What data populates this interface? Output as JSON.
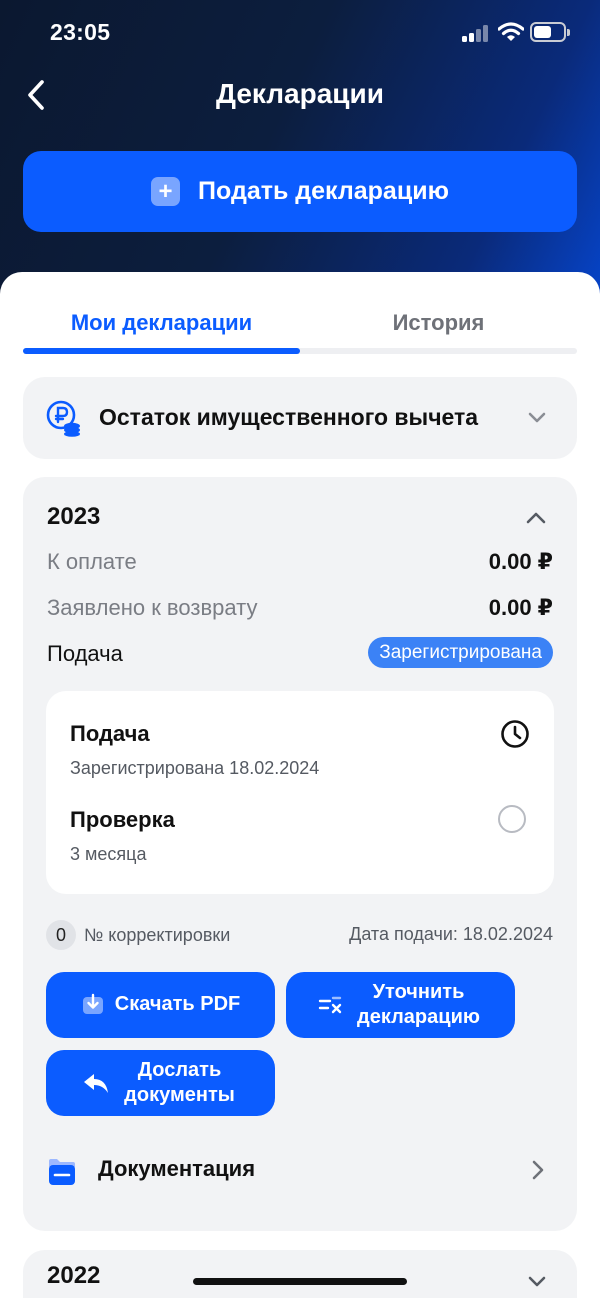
{
  "status_bar": {
    "time": "23:05"
  },
  "header": {
    "title": "Декларации",
    "submit_label": "Подать декларацию"
  },
  "tabs": [
    {
      "label": "Мои декларации",
      "active": true
    },
    {
      "label": "История",
      "active": false
    }
  ],
  "property_deduction": {
    "label": "Остаток имущественного вычета"
  },
  "declarations": [
    {
      "year": "2023",
      "expanded": true,
      "to_pay_label": "К оплате",
      "to_pay_value": "0.00 ₽",
      "refund_label": "Заявлено к возврату",
      "refund_value": "0.00 ₽",
      "filing_label": "Подача",
      "status_badge": "Зарегистрирована",
      "steps": [
        {
          "title": "Подача",
          "subtitle": "Зарегистрирована 18.02.2024",
          "icon": "clock-icon"
        },
        {
          "title": "Проверка",
          "subtitle": "3 месяца",
          "icon": "empty-circle-icon"
        }
      ],
      "correction_number": "0",
      "correction_label": "№ корректировки",
      "submission_date": "Дата подачи: 18.02.2024",
      "actions": {
        "download_pdf": "Скачать PDF",
        "clarify": "Уточнить декларацию",
        "send_docs": "Дослать документы"
      },
      "documentation_label": "Документация"
    },
    {
      "year": "2022",
      "expanded": false
    }
  ],
  "colors": {
    "accent": "#0b5cff",
    "badge": "#3b82f6",
    "card": "#f2f3f5",
    "header_dark": "#0c1e3e"
  }
}
